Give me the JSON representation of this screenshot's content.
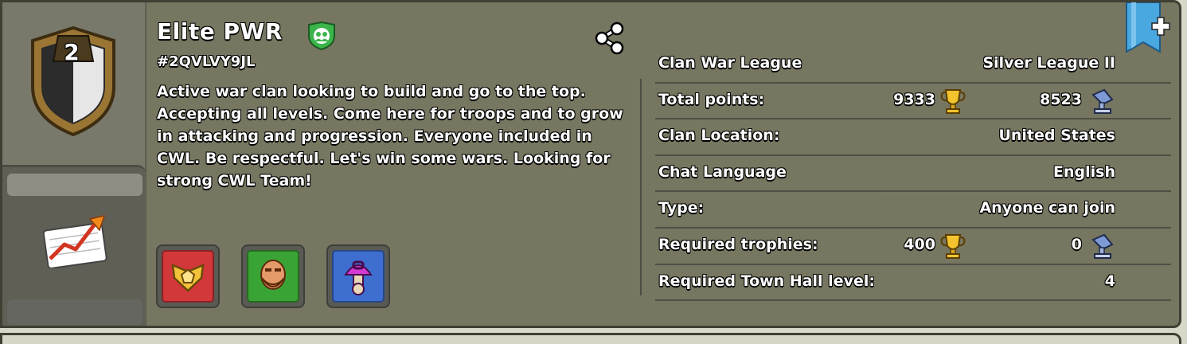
{
  "clan": {
    "name": "Elite PWR",
    "tag": "#2QVLVY9JL",
    "level": "2",
    "description": "Active war clan looking to build and go to the top. Accepting all levels. Come here for troops and to grow in attacking and progression. Everyone included in CWL. Be respectful. Let's win some wars. Looking for strong CWL Team!"
  },
  "icons": {
    "badge": "clan-badge-icon",
    "verified": "family-friendly-icon",
    "share": "share-icon",
    "stats": "chart-up-icon",
    "bookmark": "bookmark-add-icon",
    "trophy": "trophy-icon",
    "builder_trophy": "builder-trophy-icon"
  },
  "labels": [
    {
      "icon": "clan-wars-icon",
      "color": "#d2373a"
    },
    {
      "icon": "barbarian-icon",
      "color": "#3aa335"
    },
    {
      "icon": "mushroom-icon",
      "color": "#3e6fd0"
    }
  ],
  "info": {
    "cwl": {
      "label": "Clan War League",
      "value": "Silver League II"
    },
    "points": {
      "label": "Total points:",
      "trophies": "9333",
      "builder": "8523"
    },
    "location": {
      "label": "Clan Location:",
      "value": "United States"
    },
    "language": {
      "label": "Chat Language",
      "value": "English"
    },
    "type": {
      "label": "Type:",
      "value": "Anyone can join"
    },
    "req_trophies": {
      "label": "Required trophies:",
      "trophies": "400",
      "builder": "0"
    },
    "req_th": {
      "label": "Required Town Hall level:",
      "value": "4"
    }
  },
  "colors": {
    "panel": "#767661",
    "accent_ribbon": "#4aa8e0",
    "shield_green": "#3bb54a"
  }
}
